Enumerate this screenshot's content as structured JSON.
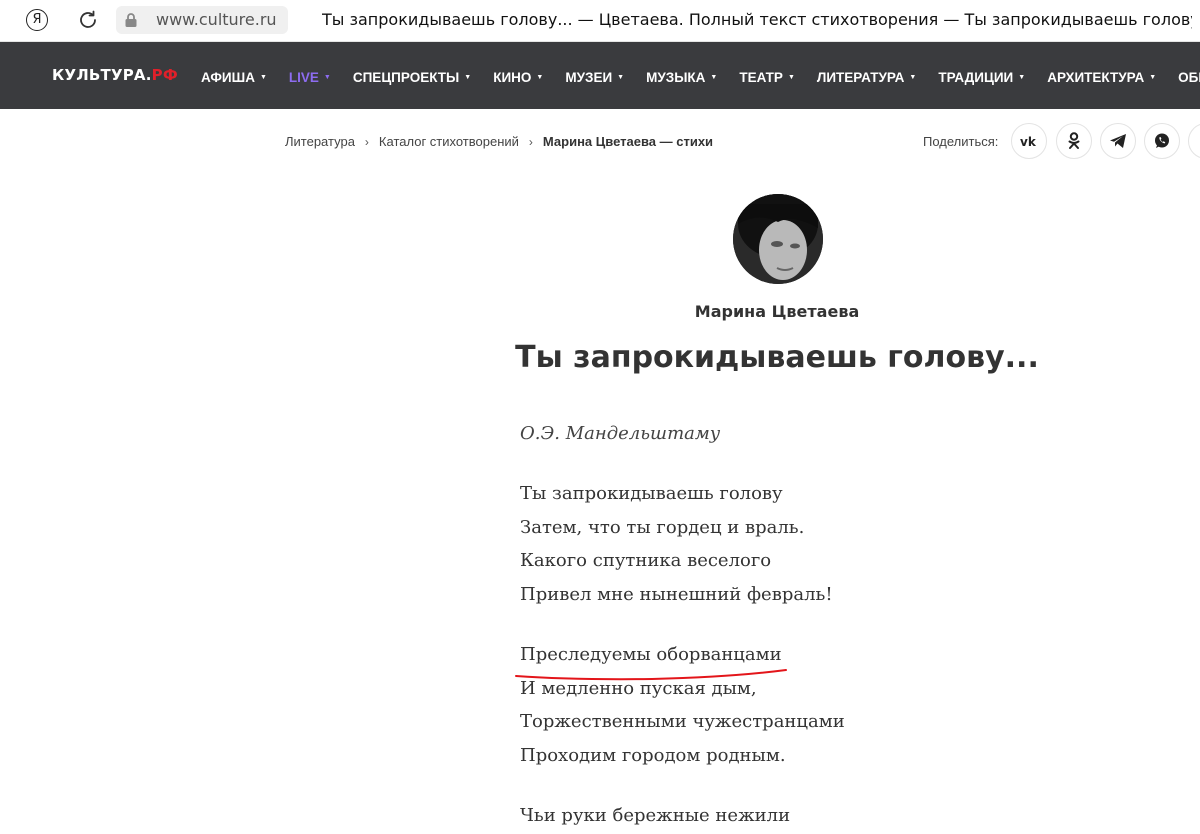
{
  "browser": {
    "logo_glyph": "Я",
    "url": "www.culture.ru",
    "tab_title": "Ты запрокидываешь голову... — Цветаева. Полный текст стихотворения — Ты запрокидываешь голову..."
  },
  "site": {
    "logo_main": "КУЛЬТУРА.",
    "logo_accent": "РФ",
    "nav": [
      {
        "label": "АФИША"
      },
      {
        "label": "LIVE"
      },
      {
        "label": "СПЕЦПРОЕКТЫ"
      },
      {
        "label": "КИНО"
      },
      {
        "label": "МУЗЕИ"
      },
      {
        "label": "МУЗЫКА"
      },
      {
        "label": "ТЕАТР"
      },
      {
        "label": "ЛИТЕРАТУРА"
      },
      {
        "label": "ТРАДИЦИИ"
      },
      {
        "label": "АРХИТЕКТУРА"
      },
      {
        "label": "ОБРАЗОВ"
      }
    ],
    "colors": {
      "nav_bg": "#3a3b3e",
      "live": "#8d6cf0",
      "accent": "#e0202a"
    }
  },
  "breadcrumb": {
    "items": [
      "Литература",
      "Каталог стихотворений"
    ],
    "current": "Марина Цветаева — стихи"
  },
  "share": {
    "label": "Поделиться:",
    "icons": [
      "vk-icon",
      "odnoklassniki-icon",
      "telegram-icon",
      "whatsapp-icon"
    ]
  },
  "author": {
    "name": "Марина Цветаева"
  },
  "poem": {
    "title": "Ты запрокидываешь голову...",
    "dedication": "О.Э. Мандельштаму",
    "stanzas": [
      [
        "Ты запрокидываешь голову",
        "Затем, что ты гордец и враль.",
        "Какого спутника веселого",
        "Привел мне нынешний февраль!"
      ],
      [
        "Преследуемы оборванцами",
        "И медленно пуская дым,",
        "Торжественными чужестранцами",
        "Проходим городом родным."
      ],
      [
        "Чьи руки бережные нежили"
      ]
    ],
    "underline_color": "#e3151a"
  }
}
